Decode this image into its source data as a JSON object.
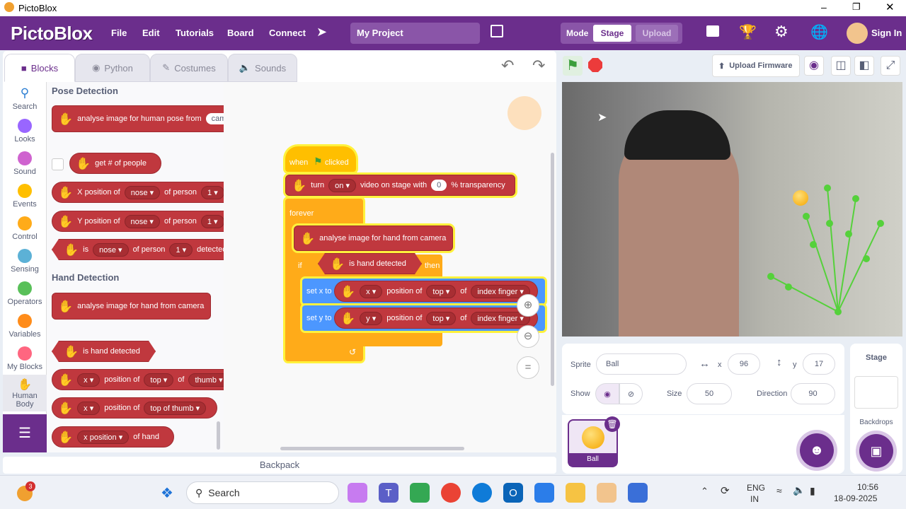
{
  "window": {
    "title": "PictoBlox"
  },
  "menu": {
    "logo": "PictoBlox",
    "file": "File",
    "edit": "Edit",
    "tutorials": "Tutorials",
    "board": "Board",
    "connect": "Connect",
    "project_name": "My Project",
    "mode_label": "Mode",
    "stage_btn": "Stage",
    "upload_btn": "Upload",
    "sign_in": "Sign In"
  },
  "tabs": {
    "blocks": "Blocks",
    "python": "Python",
    "costumes": "Costumes",
    "sounds": "Sounds"
  },
  "categories": [
    {
      "label": "Search",
      "color": "#2d7fd3"
    },
    {
      "label": "Looks",
      "color": "#9966ff"
    },
    {
      "label": "Sound",
      "color": "#cf63cf"
    },
    {
      "label": "Events",
      "color": "#ffbf00"
    },
    {
      "label": "Control",
      "color": "#ffab19"
    },
    {
      "label": "Sensing",
      "color": "#5cb1d6"
    },
    {
      "label": "Operators",
      "color": "#59c059"
    },
    {
      "label": "Variables",
      "color": "#ff8c1a"
    },
    {
      "label": "My Blocks",
      "color": "#ff6680"
    },
    {
      "label": "Human Body",
      "color": "#c0383e"
    }
  ],
  "palette": {
    "pose_header": "Pose Detection",
    "pose_analyse": "analyse image for human pose from",
    "pose_analyse_src": "camera",
    "get_people": "get # of people",
    "xpos_label": "X position of",
    "ypos_label": "Y position of",
    "nose": "nose",
    "of_person": "of person",
    "one": "1",
    "is_label": "is",
    "detected": "detected",
    "hand_header": "Hand Detection",
    "hand_analyse": "analyse image for hand from camera",
    "is_hand_detected": "is hand detected",
    "x": "x",
    "position_of": "position of",
    "top": "top",
    "of": "of",
    "thumb": "thumb",
    "top_of_thumb": "top of thumb",
    "x_position": "x position",
    "of_hand": "of hand"
  },
  "script": {
    "when": "when",
    "clicked": "clicked",
    "turn": "turn",
    "on": "on",
    "video_on_stage": "video on stage with",
    "transparency_val": "0",
    "transparency": "% transparency",
    "forever": "forever",
    "analyse_hand": "analyse image for hand from camera",
    "if": "if",
    "is_hand_detected": "is hand detected",
    "then": "then",
    "set_x_to": "set x to",
    "set_y_to": "set y to",
    "x": "x",
    "y": "y",
    "position_of": "position of",
    "top": "top",
    "of": "of",
    "index_finger": "index finger"
  },
  "toolbar": {
    "upload_firmware": "Upload Firmware"
  },
  "sprite": {
    "sprite_label": "Sprite",
    "name": "Ball",
    "x_label": "x",
    "x_value": "96",
    "y_label": "y",
    "y_value": "17",
    "show_label": "Show",
    "size_label": "Size",
    "size_value": "50",
    "direction_label": "Direction",
    "direction_value": "90",
    "thumb_name": "Ball"
  },
  "stage_side": {
    "stage": "Stage",
    "backdrops": "Backdrops"
  },
  "backpack": "Backpack",
  "taskbar": {
    "search": "Search",
    "badge": "3",
    "lang1": "ENG",
    "lang2": "IN",
    "time": "10:56",
    "date": "18-09-2025"
  }
}
